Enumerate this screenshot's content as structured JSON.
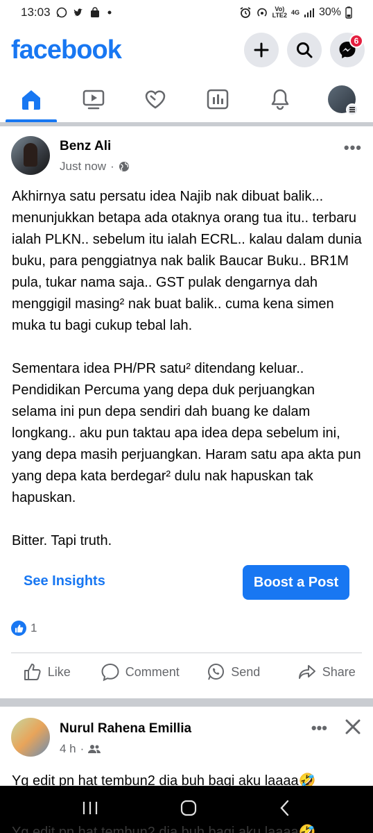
{
  "status_bar": {
    "time": "13:03",
    "network_top": "Vo)",
    "network_bottom": "LTE2",
    "signal_label": "4G",
    "battery": "30%"
  },
  "header": {
    "logo": "facebook",
    "messenger_badge": "6"
  },
  "tabs": [
    "home-icon",
    "watch-icon",
    "dating-icon",
    "dashboard-icon",
    "notifications-icon",
    "profile-menu"
  ],
  "post": {
    "author": "Benz Ali",
    "time": "Just now",
    "dot": "·",
    "paragraphs": [
      "Akhirnya satu persatu idea Najib nak dibuat balik... menunjukkan betapa ada otaknya orang tua itu.. terbaru ialah PLKN.. sebelum itu ialah ECRL.. kalau dalam dunia buku, para penggiatnya nak balik Baucar Buku.. BR1M pula, tukar nama saja.. GST pulak dengarnya dah menggigil masing² nak buat balik.. cuma kena simen muka tu bagi cukup tebal lah.",
      "Sementara idea PH/PR satu² ditendang keluar.. Pendidikan Percuma yang depa duk perjuangkan selama ini pun depa sendiri dah buang ke dalam longkang.. aku pun taktau apa idea depa sebelum ini, yang depa masih perjuangkan. Haram satu apa akta pun yang depa kata berdegar² dulu nak hapuskan tak hapuskan.",
      "Bitter. Tapi truth."
    ],
    "see_insights": "See Insights",
    "boost": "Boost a Post",
    "reaction_count": "1",
    "actions": {
      "like": "Like",
      "comment": "Comment",
      "send": "Send",
      "share": "Share"
    }
  },
  "post2": {
    "author": "Nurul Rahena Emillia",
    "time": "4 h",
    "dot": "·",
    "text": "Yg edit pn hat tembun2 dia buh bagi aku laaaa🤣",
    "ghost_text": "Yg edit pn hat tembun2 dia buh bagi aku laaaa🤣"
  },
  "colors": {
    "brand": "#1877f2",
    "secondary_text": "#65676b",
    "badge": "#e41e3f"
  }
}
